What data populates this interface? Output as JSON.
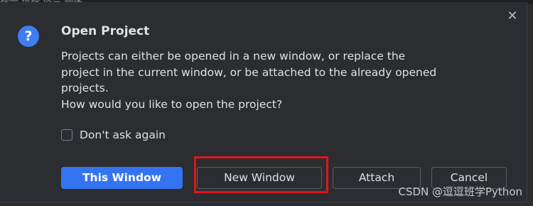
{
  "background": {
    "partial_text": "择一 选择 适合 顺序"
  },
  "dialog": {
    "title": "Open Project",
    "message_lines": [
      "Projects can either be opened in a new window, or replace the",
      "project in the current window, or be attached to the already opened",
      "projects.",
      "How would you like to open the project?"
    ],
    "checkbox": {
      "label": "Don't ask again",
      "checked": false
    },
    "buttons": {
      "this_window": "This Window",
      "new_window": "New Window",
      "attach": "Attach",
      "cancel": "Cancel"
    },
    "close_glyph": "✕",
    "help_glyph": "?"
  },
  "colors": {
    "accent": "#3574f0",
    "help_icon": "#3f7ef0",
    "highlight": "#e3141b",
    "dialog_bg": "#2b2d30",
    "text": "#dfe1e5"
  },
  "watermark": "CSDN @逗逗班学Python"
}
